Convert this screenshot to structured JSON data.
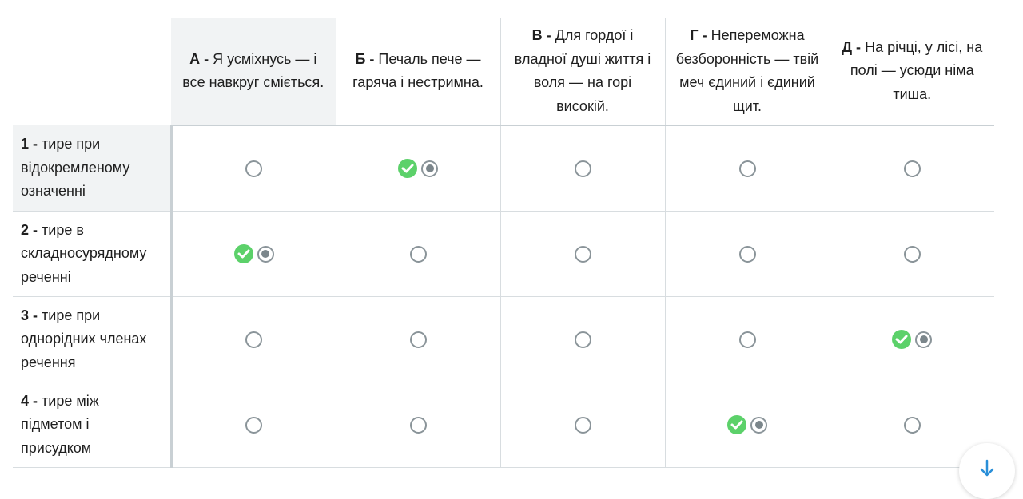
{
  "accent": {
    "correct": "#5cd16a",
    "radio": "#7b868b"
  },
  "columns": [
    {
      "letter": "А -",
      "text": "Я усміхнусь — і все навкруг сміється."
    },
    {
      "letter": "Б -",
      "text": "Печаль пече — гаряча і нестримна."
    },
    {
      "letter": "В -",
      "text": "Для гордої і владної душі життя і воля — на горі високій."
    },
    {
      "letter": "Г -",
      "text": "Непереможна безборонність — твій меч єдиний і єдиний щит."
    },
    {
      "letter": "Д -",
      "text": "На річці, у лісі, на полі — усюди німа тиша."
    }
  ],
  "rows": [
    {
      "number": "1 -",
      "text": "тире при відокремленому означенні"
    },
    {
      "number": "2 -",
      "text": "тире в складносурядному реченні"
    },
    {
      "number": "3 -",
      "text": "тире при однорідних членах речення"
    },
    {
      "number": "4 -",
      "text": "тире між підметом і присудком"
    }
  ],
  "answers": [
    {
      "row": 1,
      "column": "Б",
      "selected": true,
      "correct": true
    },
    {
      "row": 2,
      "column": "А",
      "selected": true,
      "correct": true
    },
    {
      "row": 3,
      "column": "Д",
      "selected": true,
      "correct": true
    },
    {
      "row": 4,
      "column": "Г",
      "selected": true,
      "correct": true
    }
  ],
  "icons": {
    "correct": "check-circle-icon",
    "radio": "radio-icon",
    "scroll": "arrow-down-icon"
  }
}
